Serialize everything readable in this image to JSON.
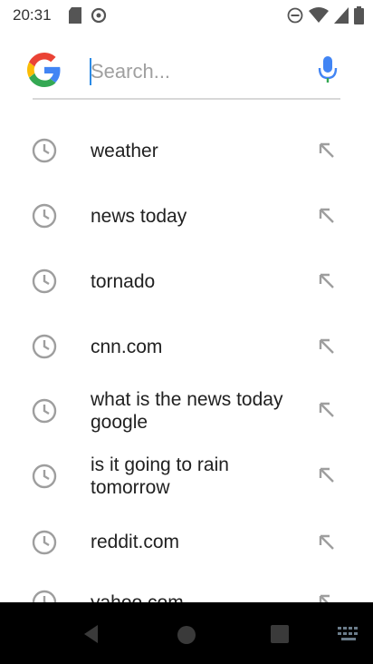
{
  "status_bar": {
    "time": "20:31",
    "icons": [
      "sd-card-icon",
      "sync-icon",
      "dnd-icon",
      "wifi-icon",
      "signal-icon",
      "battery-icon"
    ]
  },
  "search": {
    "placeholder": "Search...",
    "value": ""
  },
  "suggestions": [
    {
      "text": "weather"
    },
    {
      "text": "news today"
    },
    {
      "text": "tornado"
    },
    {
      "text": "cnn.com"
    },
    {
      "text": "what is the news today google"
    },
    {
      "text": "is it going to rain tomorrow"
    },
    {
      "text": "reddit.com"
    },
    {
      "text": "yahoo.com"
    }
  ],
  "colors": {
    "google_blue": "#4285F4",
    "google_red": "#EA4335",
    "google_yellow": "#FBBC05",
    "google_green": "#34A853",
    "icon_gray": "#9e9e9e",
    "nav_bg": "#000000"
  },
  "nav_bar": {
    "buttons": [
      "back-button",
      "home-button",
      "recents-button",
      "keyboard-button"
    ]
  }
}
